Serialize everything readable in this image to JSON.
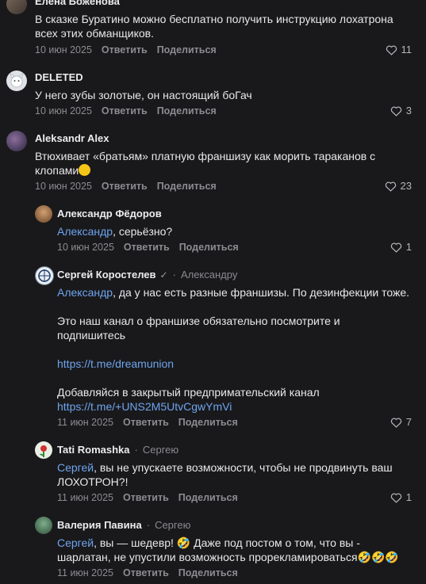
{
  "actions": {
    "reply": "Ответить",
    "share": "Поделиться"
  },
  "comments": [
    {
      "author": "Елена Боженова",
      "reply_to": "",
      "line1": "В сказке Буратино можно бесплатно получить инструкцию лохатрона",
      "line2": "всех этих обманщиков.",
      "date": "10 июн 2025",
      "likes": "11"
    },
    {
      "author": "DELETED",
      "line1": "У него зубы золотые, он настоящий боГач",
      "date": "10 июн 2025",
      "likes": "3"
    },
    {
      "author": "Aleksandr Alex",
      "line1": "Втюхивает «братьям» платную франшизу как морить тараканов с",
      "line2": "клопами",
      "emoji": "😳",
      "date": "10 июн 2025",
      "likes": "23"
    },
    {
      "author": "Александр Фёдоров",
      "mention": "Александр",
      "line1": ", серьёзно?",
      "date": "10 июн 2025",
      "likes": "1"
    },
    {
      "author": "Сергей Коростелев",
      "check": "✓",
      "reply_to": "Александру",
      "mention": "Александр",
      "line1": ", да у нас есть разные франшизы. По дезинфекции тоже.",
      "line2": "Это наш канал о франшизе обязательно посмотрите и",
      "line3": "подпишитесь",
      "link1": "https://t.me/dreamunion",
      "line4": "Добавляйся в закрытый предпримательский канал",
      "link2": "https://t.me/+UNS2M5UtvCgwYmVi",
      "date": "11 июн 2025",
      "likes": "7"
    },
    {
      "author": "Tati Romashka",
      "reply_to": "Сергею",
      "mention": "Сергей",
      "line1": ", вы не упускаете возможности, чтобы не продвинуть ваш",
      "line2": "ЛОХОТРОН?!",
      "date": "11 июн 2025",
      "likes": "1"
    },
    {
      "author": "Валерия Павина",
      "reply_to": "Сергею",
      "mention": "Сергей",
      "line1": ", вы — шедевр! 🤣 Даже под постом о том, что вы -",
      "line2": "шарлатан, не упустили возможность прорекламироваться🤣🤣🤣",
      "date": "11 июн 2025",
      "likes": ""
    }
  ]
}
